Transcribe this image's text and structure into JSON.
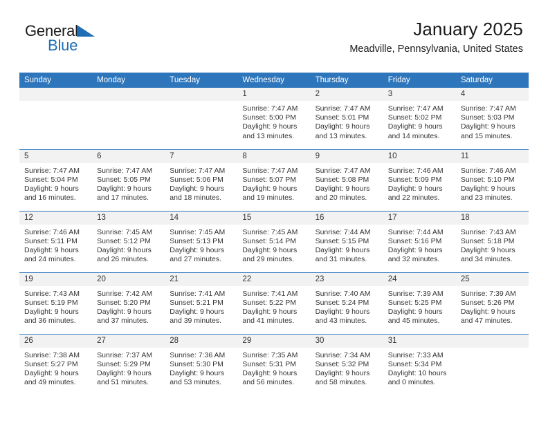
{
  "brand": {
    "name_part1": "General",
    "name_part2": "Blue",
    "flag_icon": "triangle-flag-icon",
    "accent_color": "#1f6eb5"
  },
  "header": {
    "title": "January 2025",
    "subtitle": "Meadville, Pennsylvania, United States"
  },
  "calendar": {
    "header_background": "#2e76bc",
    "daynum_background": "#f2f2f2",
    "weekday_headers": [
      "Sunday",
      "Monday",
      "Tuesday",
      "Wednesday",
      "Thursday",
      "Friday",
      "Saturday"
    ],
    "weeks": [
      [
        {
          "day": "",
          "empty": true
        },
        {
          "day": "",
          "empty": true
        },
        {
          "day": "",
          "empty": true
        },
        {
          "day": "1",
          "sunrise": "Sunrise: 7:47 AM",
          "sunset": "Sunset: 5:00 PM",
          "daylight_line1": "Daylight: 9 hours",
          "daylight_line2": "and 13 minutes."
        },
        {
          "day": "2",
          "sunrise": "Sunrise: 7:47 AM",
          "sunset": "Sunset: 5:01 PM",
          "daylight_line1": "Daylight: 9 hours",
          "daylight_line2": "and 13 minutes."
        },
        {
          "day": "3",
          "sunrise": "Sunrise: 7:47 AM",
          "sunset": "Sunset: 5:02 PM",
          "daylight_line1": "Daylight: 9 hours",
          "daylight_line2": "and 14 minutes."
        },
        {
          "day": "4",
          "sunrise": "Sunrise: 7:47 AM",
          "sunset": "Sunset: 5:03 PM",
          "daylight_line1": "Daylight: 9 hours",
          "daylight_line2": "and 15 minutes."
        }
      ],
      [
        {
          "day": "5",
          "sunrise": "Sunrise: 7:47 AM",
          "sunset": "Sunset: 5:04 PM",
          "daylight_line1": "Daylight: 9 hours",
          "daylight_line2": "and 16 minutes."
        },
        {
          "day": "6",
          "sunrise": "Sunrise: 7:47 AM",
          "sunset": "Sunset: 5:05 PM",
          "daylight_line1": "Daylight: 9 hours",
          "daylight_line2": "and 17 minutes."
        },
        {
          "day": "7",
          "sunrise": "Sunrise: 7:47 AM",
          "sunset": "Sunset: 5:06 PM",
          "daylight_line1": "Daylight: 9 hours",
          "daylight_line2": "and 18 minutes."
        },
        {
          "day": "8",
          "sunrise": "Sunrise: 7:47 AM",
          "sunset": "Sunset: 5:07 PM",
          "daylight_line1": "Daylight: 9 hours",
          "daylight_line2": "and 19 minutes."
        },
        {
          "day": "9",
          "sunrise": "Sunrise: 7:47 AM",
          "sunset": "Sunset: 5:08 PM",
          "daylight_line1": "Daylight: 9 hours",
          "daylight_line2": "and 20 minutes."
        },
        {
          "day": "10",
          "sunrise": "Sunrise: 7:46 AM",
          "sunset": "Sunset: 5:09 PM",
          "daylight_line1": "Daylight: 9 hours",
          "daylight_line2": "and 22 minutes."
        },
        {
          "day": "11",
          "sunrise": "Sunrise: 7:46 AM",
          "sunset": "Sunset: 5:10 PM",
          "daylight_line1": "Daylight: 9 hours",
          "daylight_line2": "and 23 minutes."
        }
      ],
      [
        {
          "day": "12",
          "sunrise": "Sunrise: 7:46 AM",
          "sunset": "Sunset: 5:11 PM",
          "daylight_line1": "Daylight: 9 hours",
          "daylight_line2": "and 24 minutes."
        },
        {
          "day": "13",
          "sunrise": "Sunrise: 7:45 AM",
          "sunset": "Sunset: 5:12 PM",
          "daylight_line1": "Daylight: 9 hours",
          "daylight_line2": "and 26 minutes."
        },
        {
          "day": "14",
          "sunrise": "Sunrise: 7:45 AM",
          "sunset": "Sunset: 5:13 PM",
          "daylight_line1": "Daylight: 9 hours",
          "daylight_line2": "and 27 minutes."
        },
        {
          "day": "15",
          "sunrise": "Sunrise: 7:45 AM",
          "sunset": "Sunset: 5:14 PM",
          "daylight_line1": "Daylight: 9 hours",
          "daylight_line2": "and 29 minutes."
        },
        {
          "day": "16",
          "sunrise": "Sunrise: 7:44 AM",
          "sunset": "Sunset: 5:15 PM",
          "daylight_line1": "Daylight: 9 hours",
          "daylight_line2": "and 31 minutes."
        },
        {
          "day": "17",
          "sunrise": "Sunrise: 7:44 AM",
          "sunset": "Sunset: 5:16 PM",
          "daylight_line1": "Daylight: 9 hours",
          "daylight_line2": "and 32 minutes."
        },
        {
          "day": "18",
          "sunrise": "Sunrise: 7:43 AM",
          "sunset": "Sunset: 5:18 PM",
          "daylight_line1": "Daylight: 9 hours",
          "daylight_line2": "and 34 minutes."
        }
      ],
      [
        {
          "day": "19",
          "sunrise": "Sunrise: 7:43 AM",
          "sunset": "Sunset: 5:19 PM",
          "daylight_line1": "Daylight: 9 hours",
          "daylight_line2": "and 36 minutes."
        },
        {
          "day": "20",
          "sunrise": "Sunrise: 7:42 AM",
          "sunset": "Sunset: 5:20 PM",
          "daylight_line1": "Daylight: 9 hours",
          "daylight_line2": "and 37 minutes."
        },
        {
          "day": "21",
          "sunrise": "Sunrise: 7:41 AM",
          "sunset": "Sunset: 5:21 PM",
          "daylight_line1": "Daylight: 9 hours",
          "daylight_line2": "and 39 minutes."
        },
        {
          "day": "22",
          "sunrise": "Sunrise: 7:41 AM",
          "sunset": "Sunset: 5:22 PM",
          "daylight_line1": "Daylight: 9 hours",
          "daylight_line2": "and 41 minutes."
        },
        {
          "day": "23",
          "sunrise": "Sunrise: 7:40 AM",
          "sunset": "Sunset: 5:24 PM",
          "daylight_line1": "Daylight: 9 hours",
          "daylight_line2": "and 43 minutes."
        },
        {
          "day": "24",
          "sunrise": "Sunrise: 7:39 AM",
          "sunset": "Sunset: 5:25 PM",
          "daylight_line1": "Daylight: 9 hours",
          "daylight_line2": "and 45 minutes."
        },
        {
          "day": "25",
          "sunrise": "Sunrise: 7:39 AM",
          "sunset": "Sunset: 5:26 PM",
          "daylight_line1": "Daylight: 9 hours",
          "daylight_line2": "and 47 minutes."
        }
      ],
      [
        {
          "day": "26",
          "sunrise": "Sunrise: 7:38 AM",
          "sunset": "Sunset: 5:27 PM",
          "daylight_line1": "Daylight: 9 hours",
          "daylight_line2": "and 49 minutes."
        },
        {
          "day": "27",
          "sunrise": "Sunrise: 7:37 AM",
          "sunset": "Sunset: 5:29 PM",
          "daylight_line1": "Daylight: 9 hours",
          "daylight_line2": "and 51 minutes."
        },
        {
          "day": "28",
          "sunrise": "Sunrise: 7:36 AM",
          "sunset": "Sunset: 5:30 PM",
          "daylight_line1": "Daylight: 9 hours",
          "daylight_line2": "and 53 minutes."
        },
        {
          "day": "29",
          "sunrise": "Sunrise: 7:35 AM",
          "sunset": "Sunset: 5:31 PM",
          "daylight_line1": "Daylight: 9 hours",
          "daylight_line2": "and 56 minutes."
        },
        {
          "day": "30",
          "sunrise": "Sunrise: 7:34 AM",
          "sunset": "Sunset: 5:32 PM",
          "daylight_line1": "Daylight: 9 hours",
          "daylight_line2": "and 58 minutes."
        },
        {
          "day": "31",
          "sunrise": "Sunrise: 7:33 AM",
          "sunset": "Sunset: 5:34 PM",
          "daylight_line1": "Daylight: 10 hours",
          "daylight_line2": "and 0 minutes."
        },
        {
          "day": "",
          "empty": true
        }
      ]
    ]
  }
}
